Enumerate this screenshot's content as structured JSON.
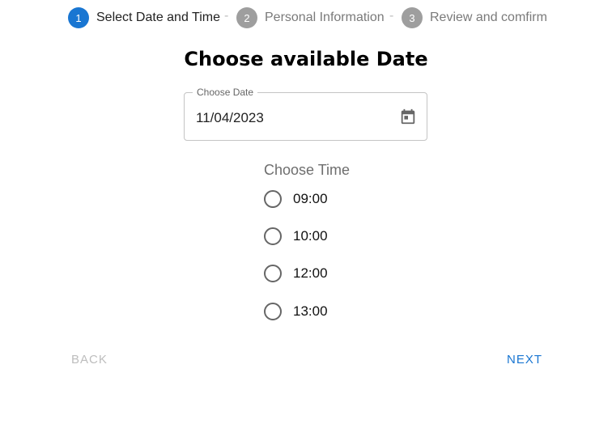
{
  "stepper": {
    "steps": [
      {
        "number": "1",
        "label": "Select Date and Time",
        "state": "active"
      },
      {
        "number": "2",
        "label": "Personal Information",
        "state": "inactive"
      },
      {
        "number": "3",
        "label": "Review and comfirm",
        "state": "inactive"
      }
    ],
    "separator": "-"
  },
  "main": {
    "title": "Choose available Date",
    "date_field": {
      "label": "Choose Date",
      "value": "11/04/2023",
      "icon": "calendar-icon"
    },
    "time": {
      "label": "Choose Time",
      "options": [
        {
          "label": "09:00",
          "selected": false
        },
        {
          "label": "10:00",
          "selected": false
        },
        {
          "label": "12:00",
          "selected": false
        },
        {
          "label": "13:00",
          "selected": false
        }
      ]
    }
  },
  "actions": {
    "back_label": "BACK",
    "next_label": "NEXT"
  },
  "colors": {
    "primary": "#1976d2",
    "inactive_step": "#9e9e9e",
    "disabled_text": "#bdbdbd"
  }
}
